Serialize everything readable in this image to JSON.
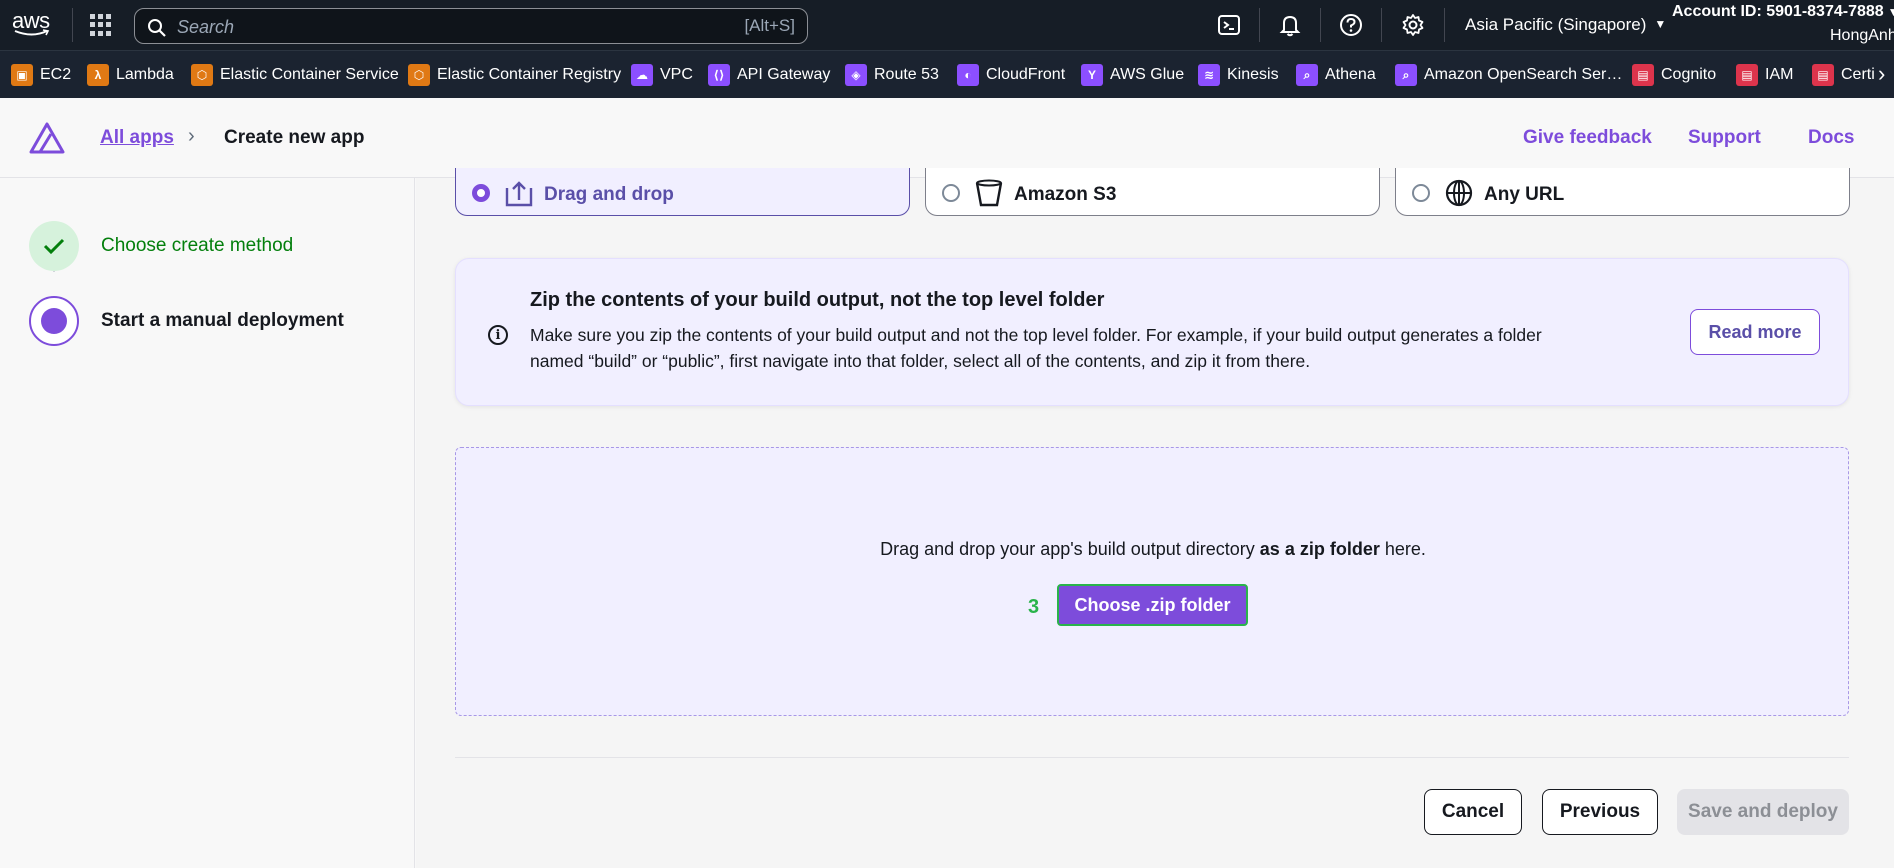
{
  "topbar": {
    "logo_text": "aws",
    "search_placeholder": "Search",
    "search_shortcut": "[Alt+S]",
    "region": "Asia Pacific (Singapore)",
    "account": "Account ID: 5901-8374-7888",
    "username": "HongAnh"
  },
  "favorites": [
    {
      "label": "EC2",
      "icon": "ec2-icon",
      "color": "#e07914"
    },
    {
      "label": "Lambda",
      "icon": "lambda-icon",
      "color": "#e07914"
    },
    {
      "label": "Elastic Container Service",
      "icon": "ecs-icon",
      "color": "#e07914"
    },
    {
      "label": "Elastic Container Registry",
      "icon": "ecr-icon",
      "color": "#e07914"
    },
    {
      "label": "VPC",
      "icon": "vpc-icon",
      "color": "#8c4fff"
    },
    {
      "label": "API Gateway",
      "icon": "api-gateway-icon",
      "color": "#8c4fff"
    },
    {
      "label": "Route 53",
      "icon": "route53-icon",
      "color": "#8c4fff"
    },
    {
      "label": "CloudFront",
      "icon": "cloudfront-icon",
      "color": "#8c4fff"
    },
    {
      "label": "AWS Glue",
      "icon": "glue-icon",
      "color": "#8c4fff"
    },
    {
      "label": "Kinesis",
      "icon": "kinesis-icon",
      "color": "#8c4fff"
    },
    {
      "label": "Athena",
      "icon": "athena-icon",
      "color": "#8c4fff"
    },
    {
      "label": "Amazon OpenSearch Ser…",
      "icon": "opensearch-icon",
      "color": "#8c4fff"
    },
    {
      "label": "Cognito",
      "icon": "cognito-icon",
      "color": "#dd344c"
    },
    {
      "label": "IAM",
      "icon": "iam-icon",
      "color": "#dd344c"
    },
    {
      "label": "Certi",
      "icon": "certificate-manager-icon",
      "color": "#dd344c"
    }
  ],
  "header": {
    "breadcrumb_link": "All apps",
    "breadcrumb_current": "Create new app",
    "feedback": "Give feedback",
    "support": "Support",
    "docs": "Docs"
  },
  "steps": [
    {
      "label": "Choose create method",
      "state": "complete"
    },
    {
      "label": "Start a manual deployment",
      "state": "active"
    }
  ],
  "options": [
    {
      "label": "Drag and drop",
      "selected": true,
      "icon": "upload-icon"
    },
    {
      "label": "Amazon S3",
      "selected": false,
      "icon": "bucket-icon"
    },
    {
      "label": "Any URL",
      "selected": false,
      "icon": "globe-icon"
    }
  ],
  "info": {
    "title": "Zip the contents of your build output, not the top level folder",
    "body": "Make sure you zip the contents of your build output and not the top level folder. For example, if your build output generates a folder named “build” or “public”, first navigate into that folder, select all of the contents, and zip it from there.",
    "read_more": "Read more"
  },
  "dropzone": {
    "text_before": "Drag and drop your app's build output directory ",
    "text_bold": "as a zip folder",
    "text_after": " here.",
    "marker": "3",
    "button": "Choose .zip folder"
  },
  "footer": {
    "cancel": "Cancel",
    "previous": "Previous",
    "save": "Save and deploy"
  },
  "colors": {
    "accent": "#7d4cdb",
    "success": "#037f0c",
    "topbar": "#161d26"
  }
}
